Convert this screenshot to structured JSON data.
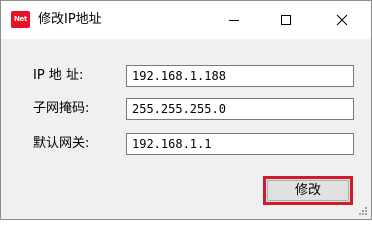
{
  "window": {
    "title": "修改IP地址",
    "app_icon_text": "Net"
  },
  "title_controls": {
    "minimize": "minimize-icon",
    "maximize": "maximize-icon",
    "close": "close-icon"
  },
  "form": {
    "ip_label": "IP 地 址:",
    "ip_value": "192.168.1.188",
    "mask_label": "子网掩码:",
    "mask_value": "255.255.255.0",
    "gateway_label": "默认网关:",
    "gateway_value": "192.168.1.1"
  },
  "actions": {
    "modify_label": "修改"
  },
  "colors": {
    "icon_red": "#e81123",
    "highlight_border": "#d11a2a",
    "window_bg": "#f0f0f0"
  }
}
